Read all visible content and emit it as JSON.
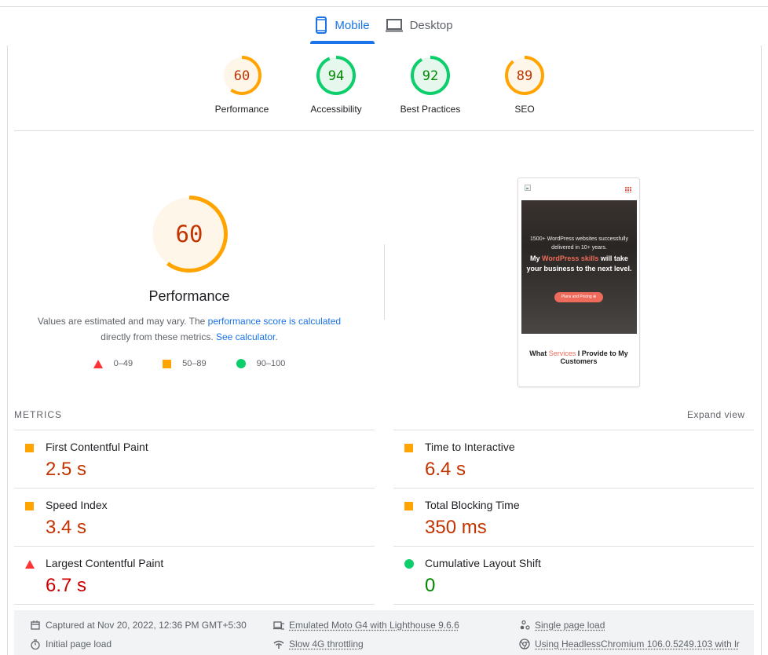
{
  "tabs": [
    {
      "label": "Mobile",
      "icon": "smartphone-icon",
      "active": true
    },
    {
      "label": "Desktop",
      "icon": "laptop-icon",
      "active": false
    }
  ],
  "categories": [
    {
      "label": "Performance",
      "score": 60,
      "rating": "average"
    },
    {
      "label": "Accessibility",
      "score": 94,
      "rating": "pass"
    },
    {
      "label": "Best Practices",
      "score": 92,
      "rating": "pass"
    },
    {
      "label": "SEO",
      "score": 89,
      "rating": "average"
    }
  ],
  "colors": {
    "pass": "#0cce6b",
    "pass_text": "#008800",
    "pass_bg": "#e6f8ee",
    "average": "#ffa400",
    "average_text": "#c33300",
    "average_bg": "#fff6ea",
    "fail": "#ff3333",
    "fail_text": "#cc0000",
    "link": "#1a73e8"
  },
  "performance": {
    "score": 60,
    "title": "Performance",
    "desc_prefix": "Values are estimated and may vary. The ",
    "link1": "performance score is calculated",
    "desc_mid": "directly from these metrics. ",
    "link2": "See calculator",
    "desc_suffix": "."
  },
  "legend": [
    {
      "shape": "triangle-icon",
      "range": "0–49"
    },
    {
      "shape": "square-icon",
      "range": "50–89"
    },
    {
      "shape": "circle-icon",
      "range": "90–100"
    }
  ],
  "screenshot": {
    "tagline": "1500+ WordPress websites successfully delivered in 10+ years.",
    "headline_pre": "My ",
    "headline_hl": "WordPress skills",
    "headline_post": " will take your business to the next level.",
    "button": "Plans and Pricing ⊕",
    "sub_pre": "What ",
    "sub_hl": "Services",
    "sub_post": " I Provide to My Customers"
  },
  "metrics": {
    "heading": "METRICS",
    "expand_label": "Expand view",
    "left": [
      {
        "label": "First Contentful Paint",
        "value": "2.5 s",
        "rating": "average"
      },
      {
        "label": "Speed Index",
        "value": "3.4 s",
        "rating": "average"
      },
      {
        "label": "Largest Contentful Paint",
        "value": "6.7 s",
        "rating": "fail"
      }
    ],
    "right": [
      {
        "label": "Time to Interactive",
        "value": "6.4 s",
        "rating": "average"
      },
      {
        "label": "Total Blocking Time",
        "value": "350 ms",
        "rating": "average"
      },
      {
        "label": "Cumulative Layout Shift",
        "value": "0",
        "rating": "pass"
      }
    ]
  },
  "footer": {
    "captured": "Captured at Nov 20, 2022, 12:36 PM GMT+5:30",
    "initial_load": "Initial page load",
    "emulated": "Emulated Moto G4 with Lighthouse 9.6.6",
    "throttling": "Slow 4G throttling",
    "single_load": "Single page load",
    "browser": "Using HeadlessChromium 106.0.5249.103 with lr"
  }
}
